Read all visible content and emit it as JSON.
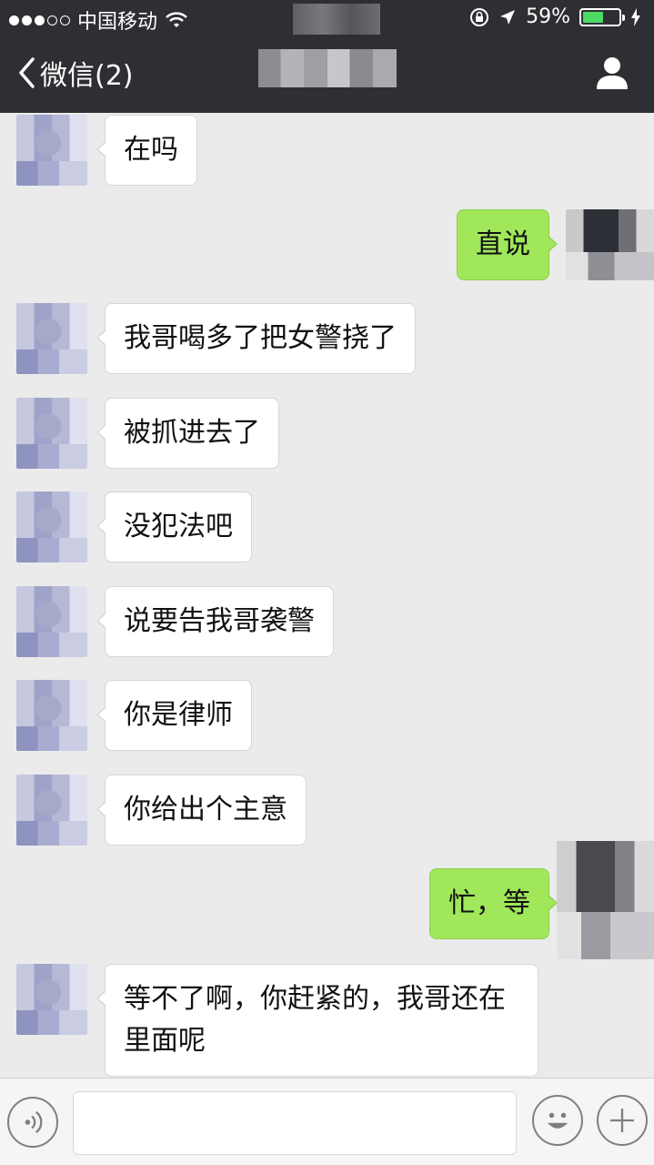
{
  "status_bar": {
    "carrier": "中国移动",
    "battery_percent": "59%",
    "battery_level": 0.59
  },
  "navbar": {
    "back_label": "微信(2)"
  },
  "messages": [
    {
      "side": "left",
      "text": "在吗"
    },
    {
      "side": "right",
      "text": "直说"
    },
    {
      "side": "left",
      "text": "我哥喝多了把女警挠了"
    },
    {
      "side": "left",
      "text": "被抓进去了"
    },
    {
      "side": "left",
      "text": "没犯法吧"
    },
    {
      "side": "left",
      "text": "说要告我哥袭警"
    },
    {
      "side": "left",
      "text": "你是律师"
    },
    {
      "side": "left",
      "text": "你给出个主意"
    },
    {
      "side": "right",
      "text": "忙，等"
    },
    {
      "side": "left",
      "text": "等不了啊，你赶紧的，我哥还在里面呢"
    }
  ],
  "input_bar": {
    "text_value": ""
  },
  "colors": {
    "header_bg": "#2e2f33",
    "chat_bg": "#ebebeb",
    "sent_bubble": "#a0e75a",
    "received_bubble": "#ffffff",
    "battery_fill": "#4cd964"
  },
  "icons": {
    "back": "chevron-left-icon",
    "profile": "user-icon",
    "voice": "voice-icon",
    "emoji": "emoji-icon",
    "more": "plus-icon",
    "signal": "signal-dots-icon",
    "wifi": "wifi-icon",
    "lock": "rotation-lock-icon",
    "location": "location-arrow-icon",
    "charging": "charging-bolt-icon"
  }
}
